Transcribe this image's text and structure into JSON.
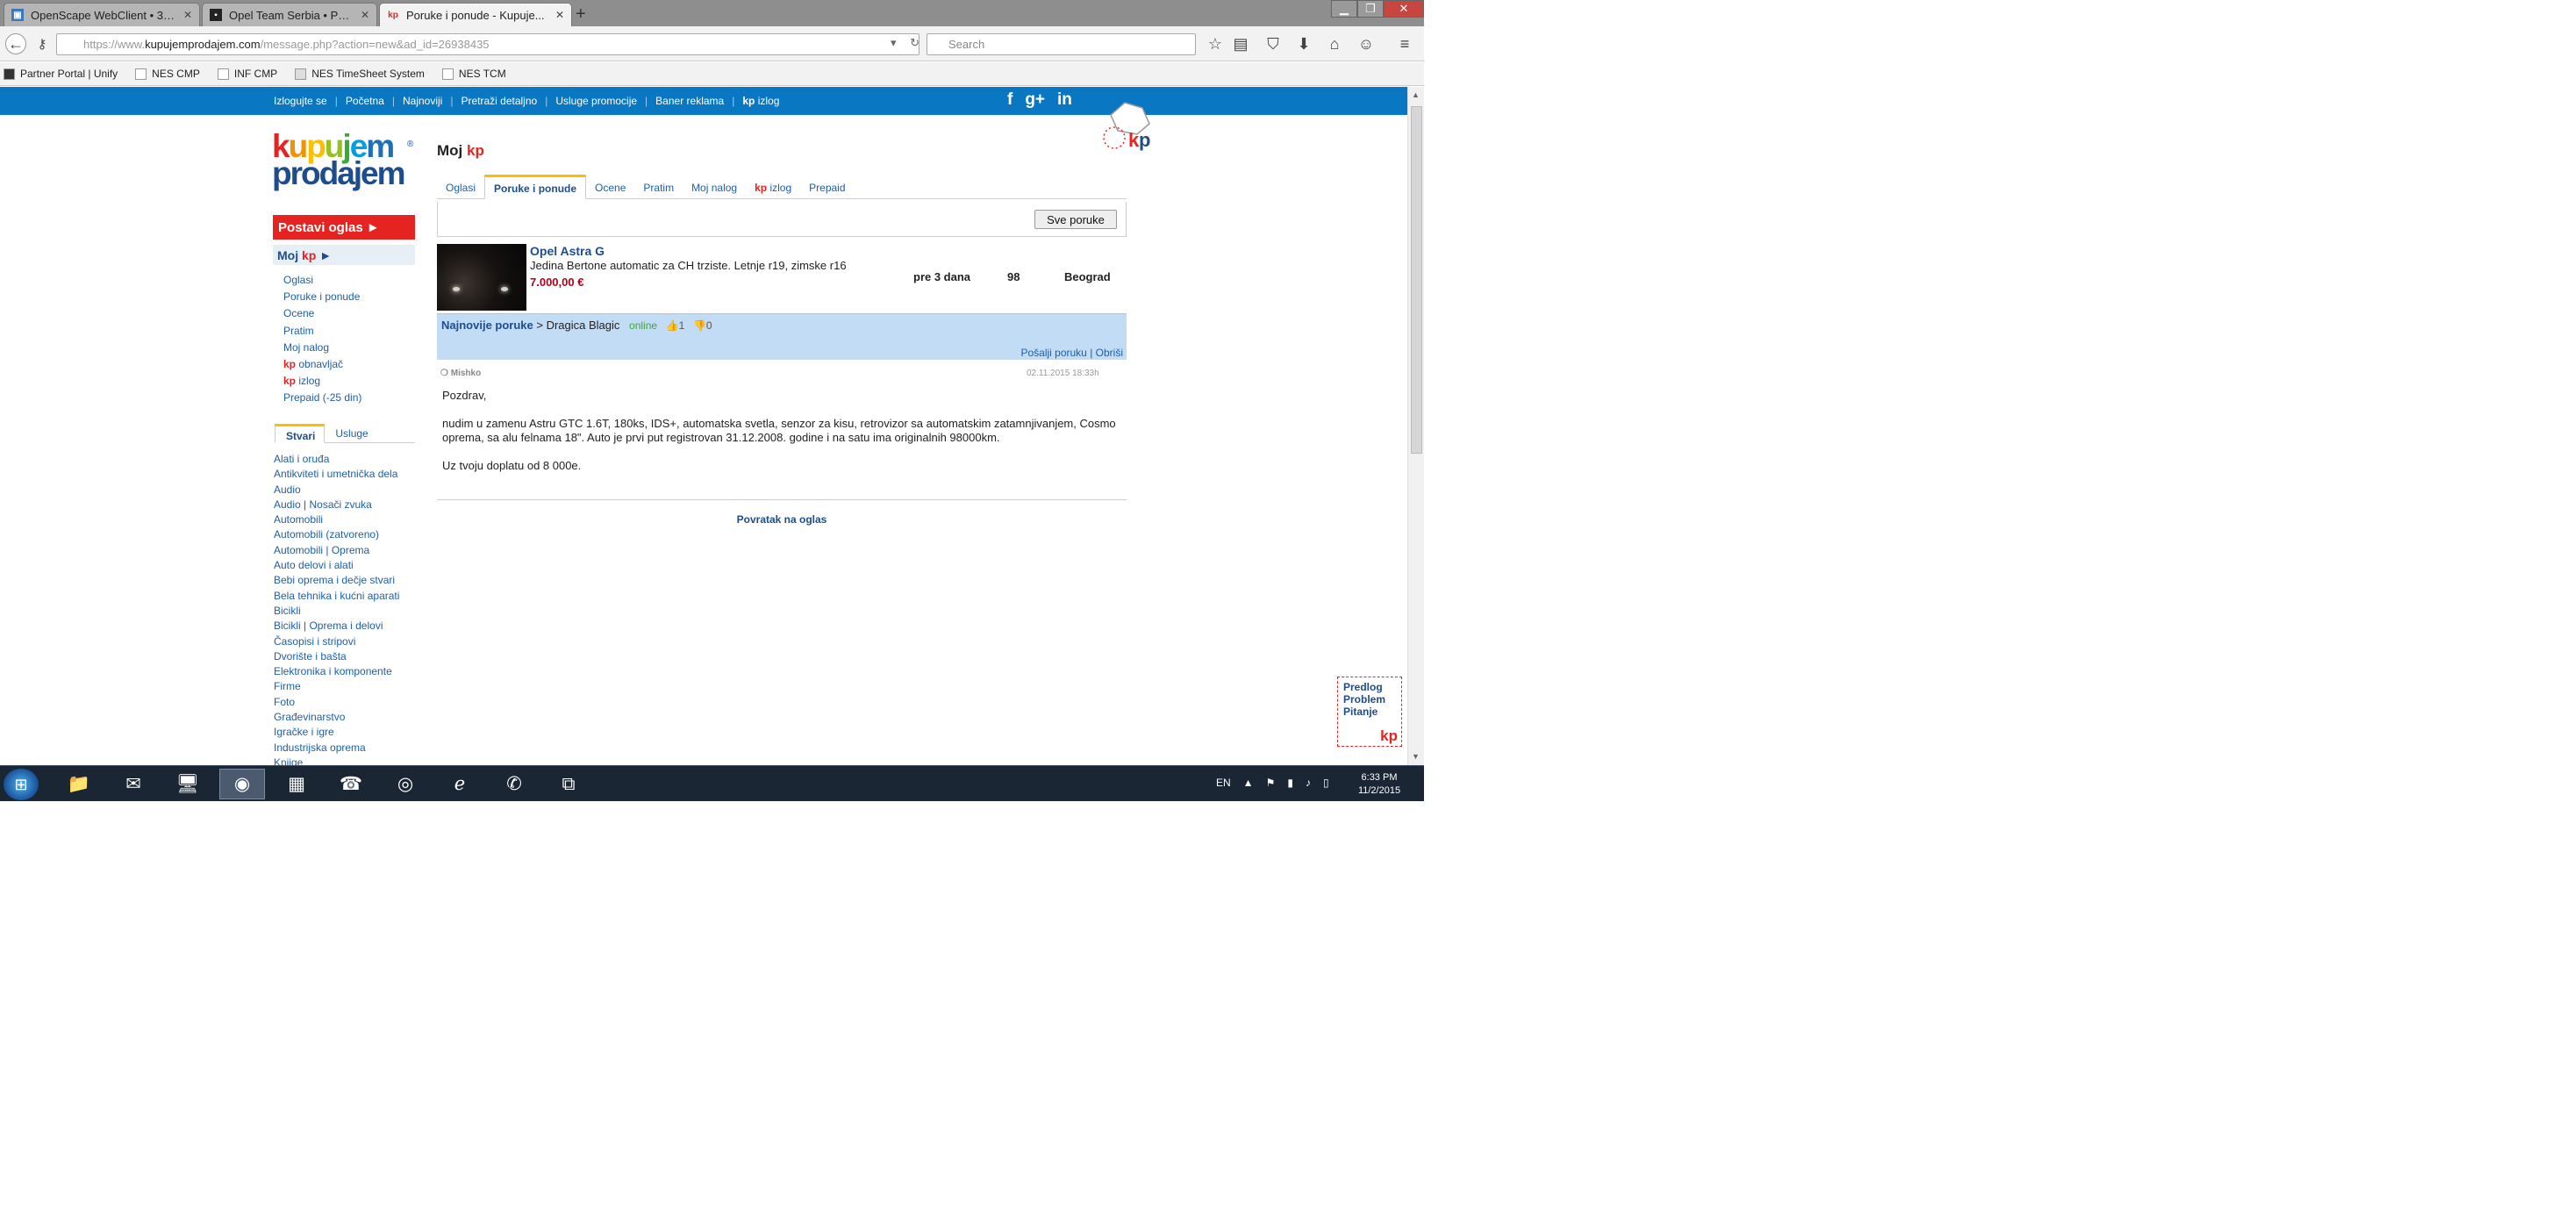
{
  "browser": {
    "tabs": [
      {
        "label": "OpenScape WebClient • 38...",
        "favicon": "openscape-icon",
        "active": false
      },
      {
        "label": "Opel Team Serbia • Pogled...",
        "favicon": "forum-icon",
        "active": false
      },
      {
        "label": "Poruke i ponude - Kupuje...",
        "favicon": "kp-icon",
        "active": true
      }
    ],
    "new_tab_label": "+",
    "url_prefix": "https://www.",
    "url_domain": "kupujemprodajem.com",
    "url_path": "/message.php?action=new&ad_id=26938435",
    "search_placeholder": "Search",
    "bookmarks": [
      "Partner Portal | Unify",
      "NES CMP",
      "INF CMP",
      "NES TimeSheet System",
      "NES TCM"
    ]
  },
  "site": {
    "topnav": [
      "Izlogujte se",
      "Početna",
      "Najnoviji",
      "Pretraži detaljno",
      "Usluge promocije",
      "Baner reklama",
      "izlog"
    ],
    "topnav_kp": "kp",
    "social": [
      "f",
      "g+",
      "in"
    ],
    "logo_line1": [
      "k",
      "u",
      "p",
      "u",
      "j",
      "e",
      "m"
    ],
    "logo_line2": "prodajem",
    "logo_reg": "®",
    "brand_colors": {
      "blue": "#0a77c3",
      "red": "#e52421",
      "navy": "#1d4d8c",
      "yellow": "#fcbf00"
    }
  },
  "left": {
    "post_ad": "Postavi oglas ►",
    "my_kp_prefix": "Moj",
    "my_kp_kp": "kp",
    "my_kp_arrow": "►",
    "menu": [
      "Oglasi",
      "Poruke i ponude",
      "Ocene",
      "Pratim",
      "Moj nalog"
    ],
    "menu_kp1": "obnavljač",
    "menu_kp2": "izlog",
    "menu_prepaid": "Prepaid (-25 din)",
    "cat_tabs": [
      "Stvari",
      "Usluge"
    ],
    "categories": [
      "Alati i oruđa",
      "Antikviteti i umetnička dela",
      "Audio",
      "Audio | Nosači zvuka",
      "Automobili",
      "Automobili (zatvoreno)",
      "Automobili | Oprema",
      "Auto delovi i alati",
      "Bebi oprema i dečje stvari",
      "Bela tehnika i kućni aparati",
      "Bicikli",
      "Bicikli | Oprema i delovi",
      "Časopisi i stripovi",
      "Dvorište i bašta",
      "Elektronika i komponente",
      "Firme",
      "Foto",
      "Građevinarstvo",
      "Igračke i igre",
      "Industrijska oprema",
      "Knjige"
    ]
  },
  "main": {
    "title_prefix": "Moj",
    "title_kp": "kp",
    "tabs": [
      "Oglasi",
      "Poruke i ponude",
      "Ocene",
      "Pratim",
      "Moj nalog",
      "izlog",
      "Prepaid"
    ],
    "tabs_kp": "kp",
    "all_messages": "Sve poruke",
    "ad": {
      "title": "Opel Astra G",
      "description": "Jedina Bertone automatic za CH trziste. Letnje r19, zimske r16",
      "price": "7.000,00 €",
      "posted": "pre 3 dana",
      "views": "98",
      "city": "Beograd"
    },
    "thread": {
      "heading": "Najnovije poruke",
      "separator": ">",
      "contact": "Dragica Blagic",
      "status": "online",
      "thumbs_up": "1",
      "thumbs_down": "0",
      "send": "Pošalji poruku",
      "delete": "Obriši"
    },
    "message": {
      "sender": "Mishko",
      "timestamp": "02.11.2015 18:33h",
      "greeting": "Pozdrav,",
      "body": "nudim u zamenu Astru GTC 1.6T, 180ks, IDS+, automatska svetla, senzor za kisu, retrovizor sa automatskim zatamnjivanjem, Cosmo oprema, sa alu felnama 18\". Auto je prvi put registrovan 31.12.2008. godine i na satu ima originalnih 98000km.",
      "closing": "Uz tvoju doplatu od 8 000e."
    },
    "back": "Povratak na oglas"
  },
  "feedback": {
    "lines": [
      "Predlog",
      "Problem",
      "Pitanje"
    ],
    "kp": "kp"
  },
  "taskbar": {
    "apps": [
      "windows-explorer-icon",
      "outlook-icon",
      "remote-desktop-icon",
      "firefox-icon",
      "app-icon",
      "phone-icon",
      "chrome-icon",
      "internet-explorer-icon",
      "viber-icon",
      "network-icon"
    ],
    "language": "EN",
    "time": "6:33 PM",
    "date": "11/2/2015"
  }
}
